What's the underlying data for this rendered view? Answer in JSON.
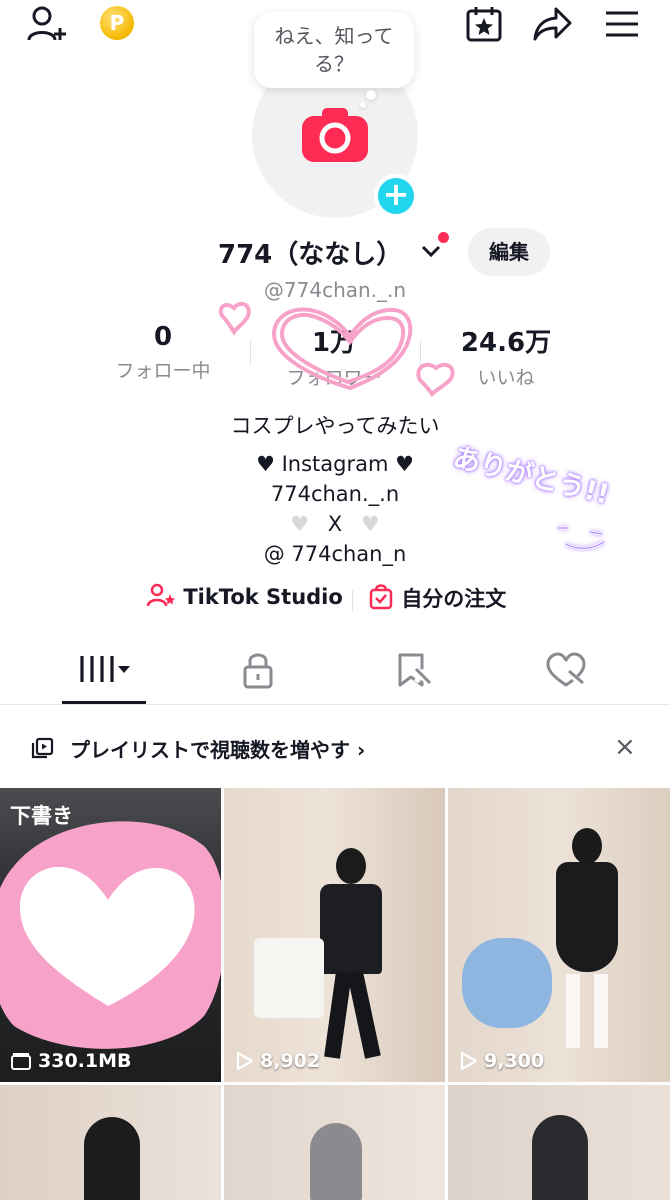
{
  "header": {
    "bubble_text_line1": "ねえ、知って",
    "bubble_text_line2": "る？",
    "coin_letter": "P"
  },
  "profile": {
    "display_name": "774（ななし）",
    "edit_label": "編集",
    "handle": "@774chan._.n"
  },
  "stats": [
    {
      "value": "0",
      "label": "フォロー中"
    },
    {
      "value": "1万",
      "label": "フォロワー"
    },
    {
      "value": "24.6万",
      "label": "いいね"
    }
  ],
  "bio": {
    "line1": "コスプレやってみたい",
    "line2": "Instagram",
    "line3": "774chan._.n",
    "line4": "X",
    "line5": "@ 774chan_n",
    "handwritten": "ありがとう!!"
  },
  "links": {
    "studio": "TikTok Studio",
    "orders": "自分の注文"
  },
  "banner": {
    "text": "プレイリストで視聴数を増やす ›",
    "close": "×"
  },
  "grid": [
    {
      "label": "下書き",
      "count": "330.1MB"
    },
    {
      "count": "8,902"
    },
    {
      "count": "9,300"
    }
  ],
  "colors": {
    "accent": "#fe2c55",
    "teal": "#20d5ec",
    "pink_scribble": "#f7a3c9"
  }
}
